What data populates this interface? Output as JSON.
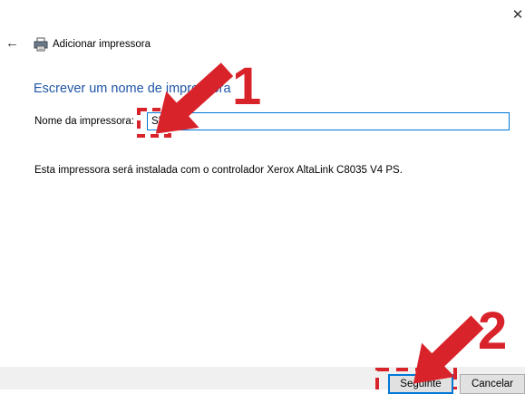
{
  "window": {
    "close_glyph": "✕"
  },
  "header": {
    "back_glyph": "←",
    "title": "Adicionar impressora",
    "icon": "printer-icon"
  },
  "main": {
    "heading": "Escrever um nome de impressora",
    "name_label": "Nome da impressora:",
    "name_value": "SP",
    "info_text": "Esta impressora será instalada com o controlador Xerox AltaLink C8035 V4 PS."
  },
  "footer": {
    "next_label": "Seguinte",
    "cancel_label": "Cancelar"
  },
  "annotations": {
    "step_one": "1",
    "step_two": "2",
    "arrow_color": "#d9232b",
    "accent": "#1f56a6",
    "focus_color": "#0078d7"
  }
}
